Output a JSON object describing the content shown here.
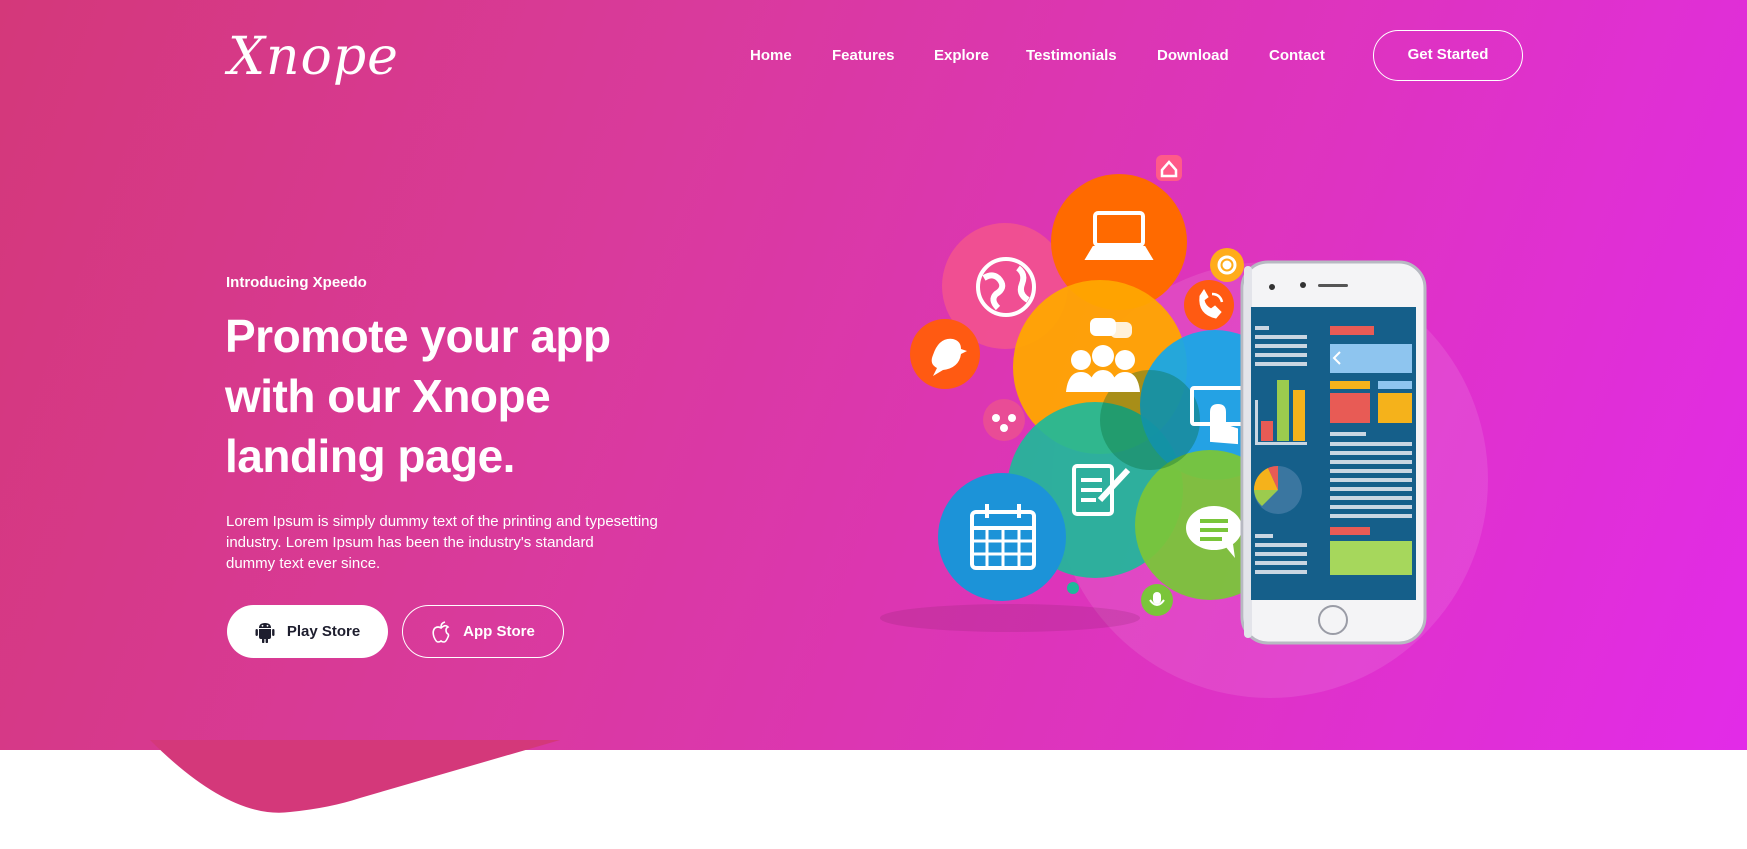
{
  "brand": {
    "logo_text": "Xnope"
  },
  "nav": {
    "items": [
      {
        "label": "Home"
      },
      {
        "label": "Features"
      },
      {
        "label": "Explore"
      },
      {
        "label": "Testimonials"
      },
      {
        "label": "Download"
      },
      {
        "label": "Contact"
      }
    ],
    "cta_label": "Get Started"
  },
  "hero": {
    "eyebrow": "Introducing Xpeedo",
    "headline_line1": "Promote your app",
    "headline_line2": "with our Xnope",
    "headline_line3": "landing page.",
    "description_line1": "Lorem Ipsum is simply dummy text of the printing and typesetting",
    "description_line2": "industry. Lorem Ipsum has been the industry's standard",
    "description_line3": "dummy text ever since.",
    "play_store_label": "Play Store",
    "app_store_label": "App Store"
  },
  "icons": {
    "android": "android-icon",
    "apple": "apple-icon"
  },
  "colors": {
    "gradient_start": "#d4387a",
    "gradient_end": "#e22be8",
    "white": "#ffffff",
    "dark_text": "#1e1e2e"
  }
}
